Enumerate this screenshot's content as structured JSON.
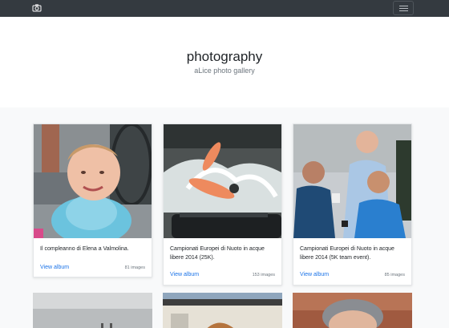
{
  "navbar": {
    "camera_icon": "camera-icon",
    "menu_icon": "hamburger-menu-icon"
  },
  "hero": {
    "title": "photography",
    "subtitle": "aLice photo gallery"
  },
  "albums": [
    {
      "title": "Il compleanno di Elena a Valmolina.",
      "link": "View album",
      "count": "81 images"
    },
    {
      "title": "Campionati Europei di Nuoto in acque libere 2014 (25K).",
      "link": "View album",
      "count": "153 images"
    },
    {
      "title": "Campionati Europei di Nuoto in acque libere 2014 (5K team event).",
      "link": "View album",
      "count": "85 images"
    }
  ],
  "colors": {
    "navbar": "#343a40",
    "link": "#1a73e8",
    "page_bg": "#f8f9fa"
  }
}
